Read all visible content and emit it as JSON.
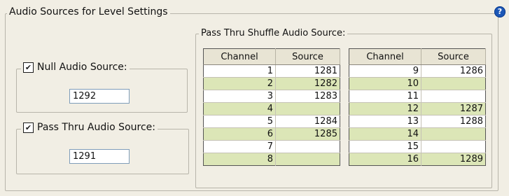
{
  "outer_title": "Audio Sources for Level Settings",
  "help_icon": "?",
  "null_source": {
    "checked": true,
    "label": "Null Audio Source:",
    "value": "1292"
  },
  "pass_thru_source": {
    "checked": true,
    "label": "Pass Thru Audio Source:",
    "value": "1291"
  },
  "shuffle": {
    "title": "Pass Thru Shuffle Audio Source:",
    "headers": [
      "Channel",
      "Source"
    ],
    "left_rows": [
      {
        "channel": "1",
        "source": "1281"
      },
      {
        "channel": "2",
        "source": "1282"
      },
      {
        "channel": "3",
        "source": "1283"
      },
      {
        "channel": "4",
        "source": ""
      },
      {
        "channel": "5",
        "source": "1284"
      },
      {
        "channel": "6",
        "source": "1285"
      },
      {
        "channel": "7",
        "source": ""
      },
      {
        "channel": "8",
        "source": ""
      }
    ],
    "right_rows": [
      {
        "channel": "9",
        "source": "1286"
      },
      {
        "channel": "10",
        "source": ""
      },
      {
        "channel": "11",
        "source": ""
      },
      {
        "channel": "12",
        "source": "1287"
      },
      {
        "channel": "13",
        "source": "1288"
      },
      {
        "channel": "14",
        "source": ""
      },
      {
        "channel": "15",
        "source": ""
      },
      {
        "channel": "16",
        "source": "1289"
      }
    ]
  },
  "colors": {
    "alt_row": "#dce6b7",
    "help_blue": "#1c57b7",
    "background": "#f1eee4"
  }
}
